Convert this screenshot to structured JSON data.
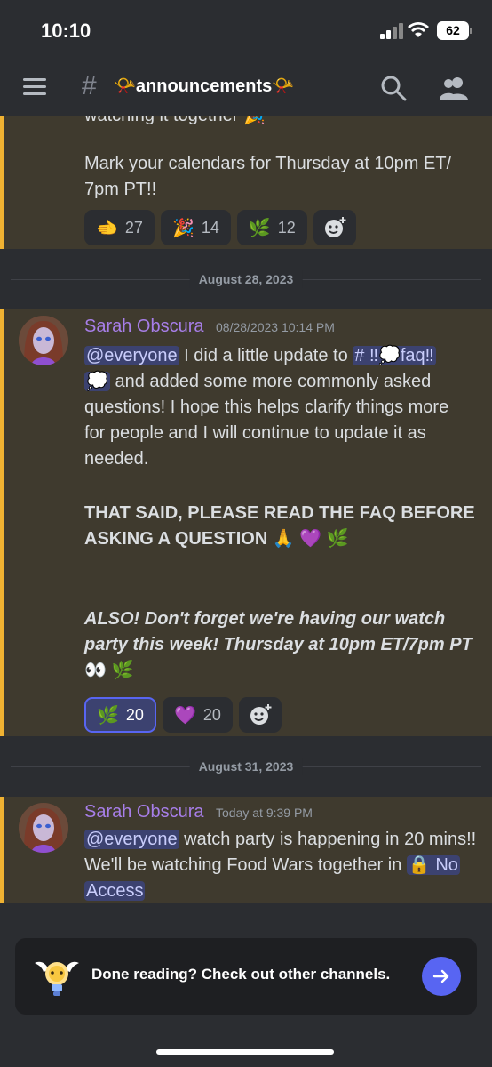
{
  "status_bar": {
    "time": "10:10",
    "battery": "62"
  },
  "header": {
    "hash": "#",
    "channel_name": "📯announcements📯"
  },
  "messages": [
    {
      "partial_line": "watching it together 🎉",
      "text": "Mark your calendars for Thursday at 10pm ET/",
      "text2": "7pm PT!!",
      "reactions": [
        {
          "emoji": "🫲",
          "count": "27"
        },
        {
          "emoji": "🎉",
          "count": "14"
        },
        {
          "emoji": "🌿",
          "count": "12"
        }
      ]
    },
    {
      "date": "August 28, 2023",
      "author": "Sarah Obscura",
      "timestamp": "08/28/2023 10:14 PM",
      "mention": "@everyone",
      "line1_rest": " I did a little update to ",
      "channel_mention": "# ‼💭faq‼",
      "channel_mention_2": "💭",
      "line2_rest": " and added some more commonly asked",
      "line3": "questions! I hope this helps clarify things more",
      "line4": "for people and I will continue to update it as",
      "line5": "needed.",
      "bold1": "THAT SAID, PLEASE READ THE FAQ BEFORE",
      "bold2": "ASKING A QUESTION 🙏 💜 🌿",
      "italic1": "ALSO! Don't forget we're having our watch",
      "italic2": "party this week! Thursday at 10pm ET/7pm PT",
      "emoji_line": "👀 🌿",
      "reactions": [
        {
          "emoji": "🌿",
          "count": "20",
          "active": true
        },
        {
          "emoji": "💜",
          "count": "20"
        }
      ]
    },
    {
      "date": "August 31, 2023",
      "author": "Sarah Obscura",
      "timestamp": "Today at 9:39 PM",
      "mention": "@everyone",
      "line1_rest": " watch party is happening in 20 mins!!",
      "line2": "We'll be watching Food Wars together in ",
      "channel_mention": "🔒 No",
      "channel_mention_2": "Access"
    }
  ],
  "bottom_card": {
    "text": "Done reading? Check out other channels."
  },
  "colors": {
    "accent": "#5865f2",
    "highlight_bar": "#f0b232",
    "author": "#a77ee8",
    "background": "#2b2d31"
  }
}
